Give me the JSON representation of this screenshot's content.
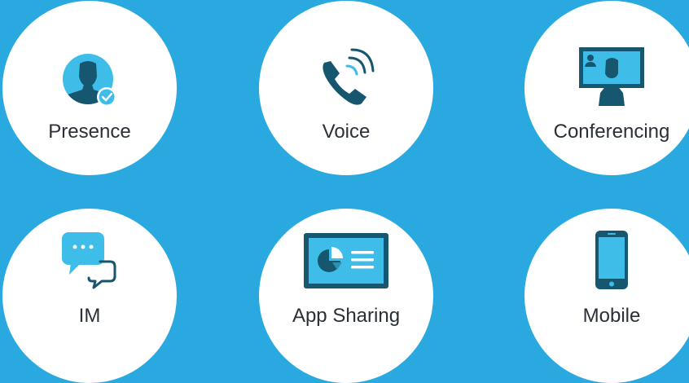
{
  "colors": {
    "background": "#29a9e0",
    "tile": "#ffffff",
    "icon_dark": "#17566f",
    "icon_light": "#3ebde9",
    "label_text": "#2a2f38"
  },
  "features": [
    {
      "label": "Presence",
      "icon": "person-presence-icon"
    },
    {
      "label": "Voice",
      "icon": "phone-handset-icon"
    },
    {
      "label": "Conferencing",
      "icon": "video-conference-icon"
    },
    {
      "label": "IM",
      "icon": "chat-bubbles-icon"
    },
    {
      "label": "App Sharing",
      "icon": "screen-share-icon"
    },
    {
      "label": "Mobile",
      "icon": "smartphone-icon"
    }
  ]
}
